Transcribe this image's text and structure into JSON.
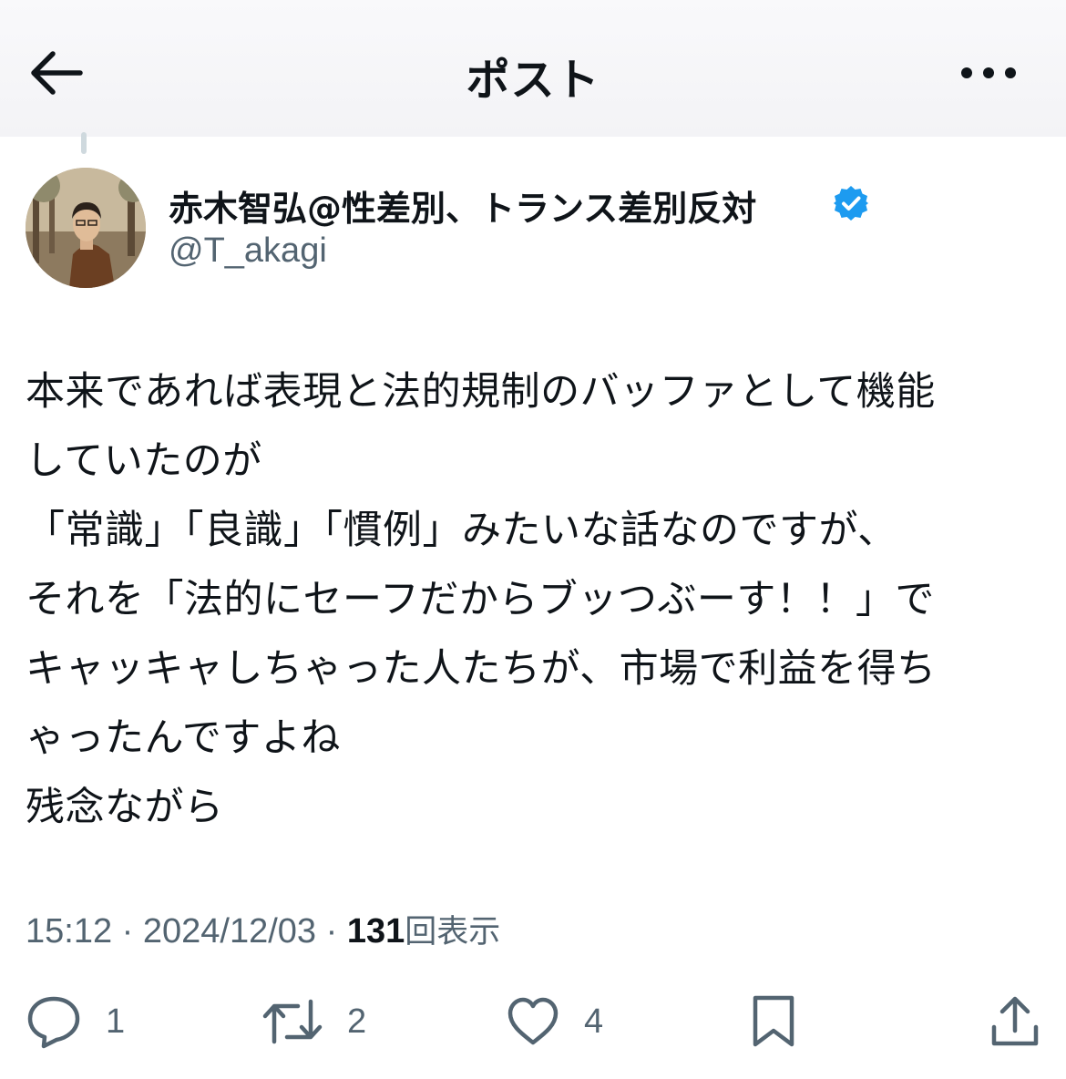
{
  "header": {
    "title": "ポスト",
    "back_icon": "arrow-left-icon",
    "more_icon": "more-horizontal-icon"
  },
  "author": {
    "display_name": "赤木智弘@性差別、トランス差別反対",
    "handle": "@T_akagi",
    "verified": true,
    "verified_color": "#1d9bf0"
  },
  "tweet": {
    "lines": [
      "本来であれば表現と法的規制のバッファとして機能",
      "していたのが",
      "「常識」「良識」「慣例」みたいな話なのですが、",
      "それを「法的にセーフだからブッつぶーす！！」で",
      "キャッキャしちゃった人たちが、市場で利益を得ち",
      "ゃったんですよね",
      "残念ながら"
    ]
  },
  "meta": {
    "time": "15:12",
    "separator": " · ",
    "date": "2024/12/03",
    "views_count": "131",
    "views_label": "回表示"
  },
  "actions": {
    "reply_count": "1",
    "repost_count": "2",
    "like_count": "4",
    "icons": [
      "reply-icon",
      "repost-icon",
      "like-icon",
      "bookmark-icon",
      "share-icon"
    ]
  },
  "colors": {
    "text": "#0f1419",
    "secondary": "#536471",
    "accent": "#1d9bf0"
  }
}
